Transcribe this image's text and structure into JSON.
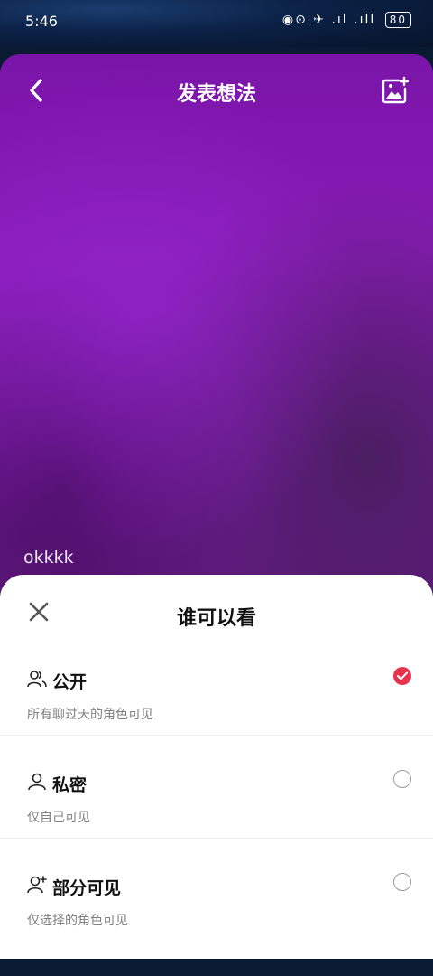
{
  "status_bar": {
    "time": "5:46",
    "icons": "◉⊙ ✈ .ıl .ıll",
    "battery": "80"
  },
  "header": {
    "title": "发表想法"
  },
  "post": {
    "text": "okkkk"
  },
  "sheet": {
    "title": "谁可以看",
    "options": [
      {
        "label": "公开",
        "description": "所有聊过天的角色可见",
        "selected": true,
        "icon": "group-icon"
      },
      {
        "label": "私密",
        "description": "仅自己可见",
        "selected": false,
        "icon": "person-icon"
      },
      {
        "label": "部分可见",
        "description": "仅选择的角色可见",
        "selected": false,
        "icon": "person-add-icon"
      }
    ]
  },
  "colors": {
    "accent": "#e8334f",
    "card_purple": "#7a14a8"
  }
}
